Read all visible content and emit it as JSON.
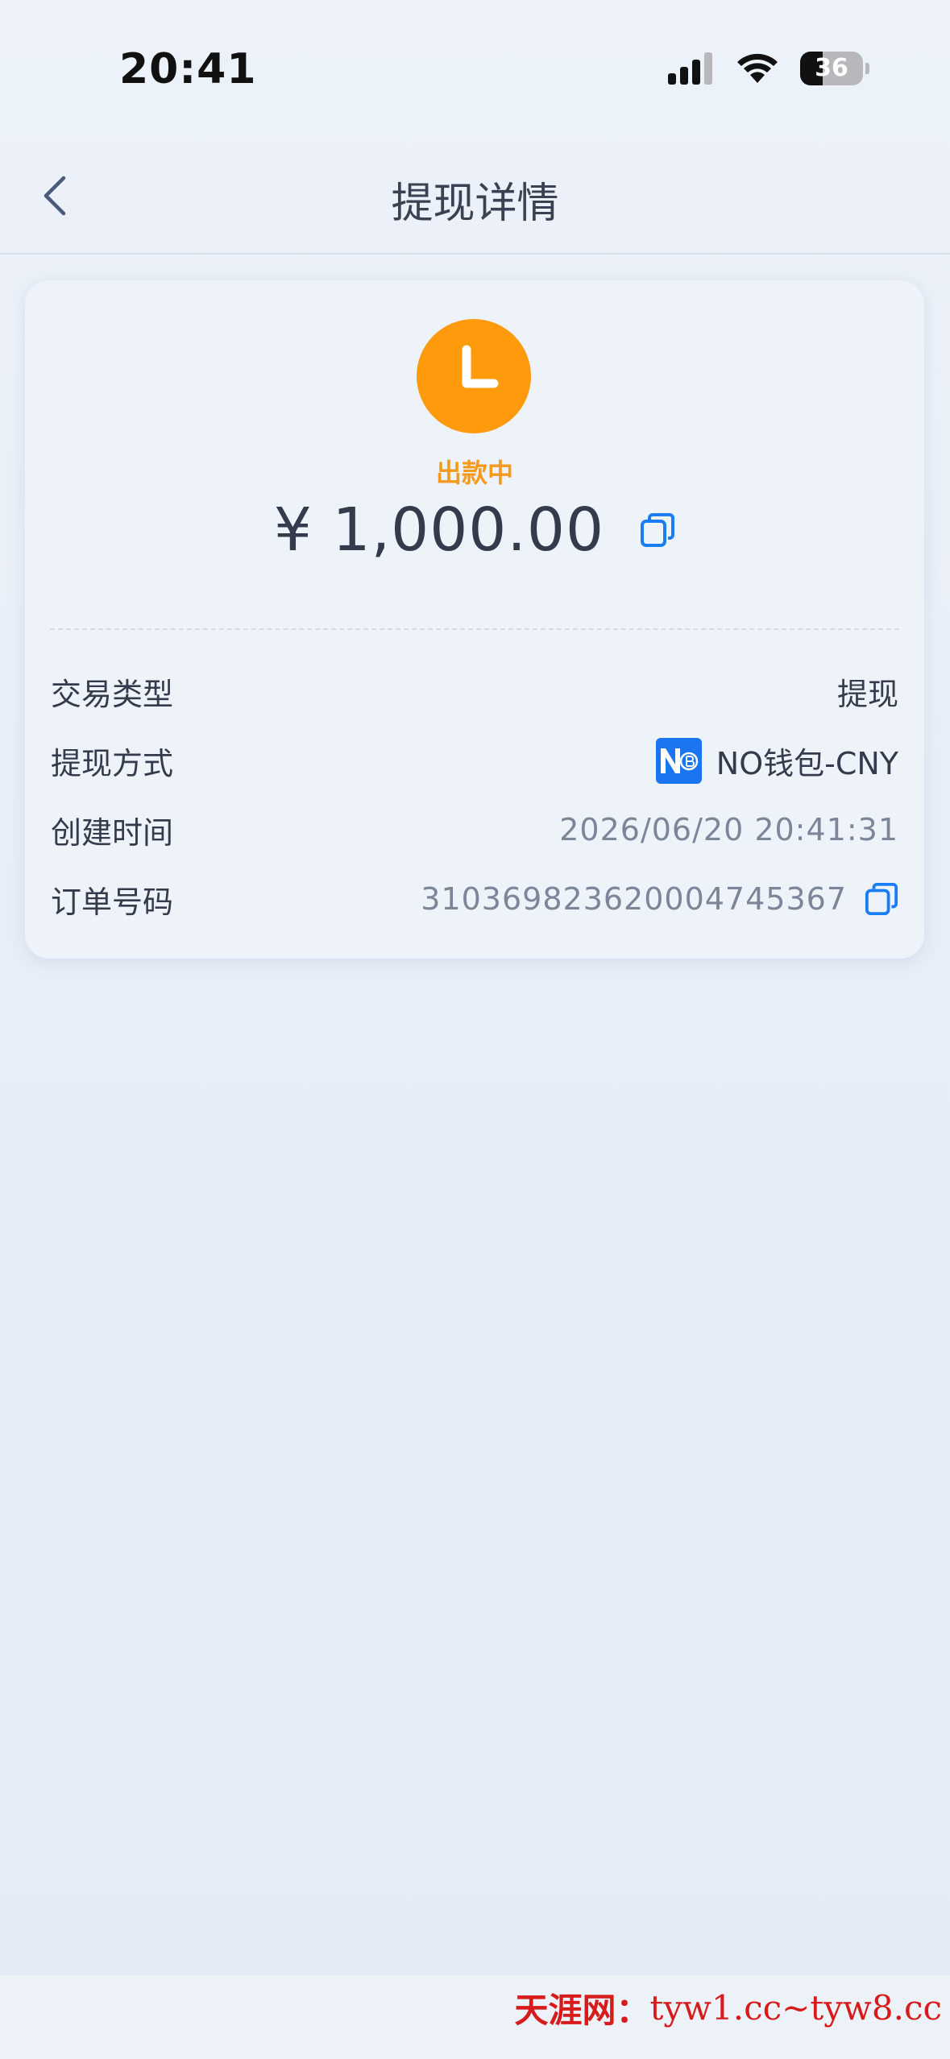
{
  "status_bar": {
    "time": "20:41",
    "battery": "36"
  },
  "nav": {
    "title": "提现详情"
  },
  "summary": {
    "status": "出款中",
    "amount": "¥ 1,000.00"
  },
  "details": [
    {
      "label": "交易类型",
      "value": "提现"
    },
    {
      "label": "提现方式",
      "value": "NO钱包-CNY"
    },
    {
      "label": "创建时间",
      "value": "2026/06/20 20:41:31"
    },
    {
      "label": "订单号码",
      "value": "310369823620004745367"
    }
  ],
  "watermark": {
    "brand": "天涯网：",
    "domains": "tyw1.cc~tyw8.cc"
  },
  "colors": {
    "status_orange": "#fe9a0b",
    "accent_blue": "#1976f0",
    "text_dark": "#353b4c",
    "text_muted": "#7d8699"
  },
  "icons": {
    "back": "chevron-left-icon",
    "status": "clock-icon",
    "copy": "copy-icon",
    "wallet": "no-wallet-logo"
  }
}
